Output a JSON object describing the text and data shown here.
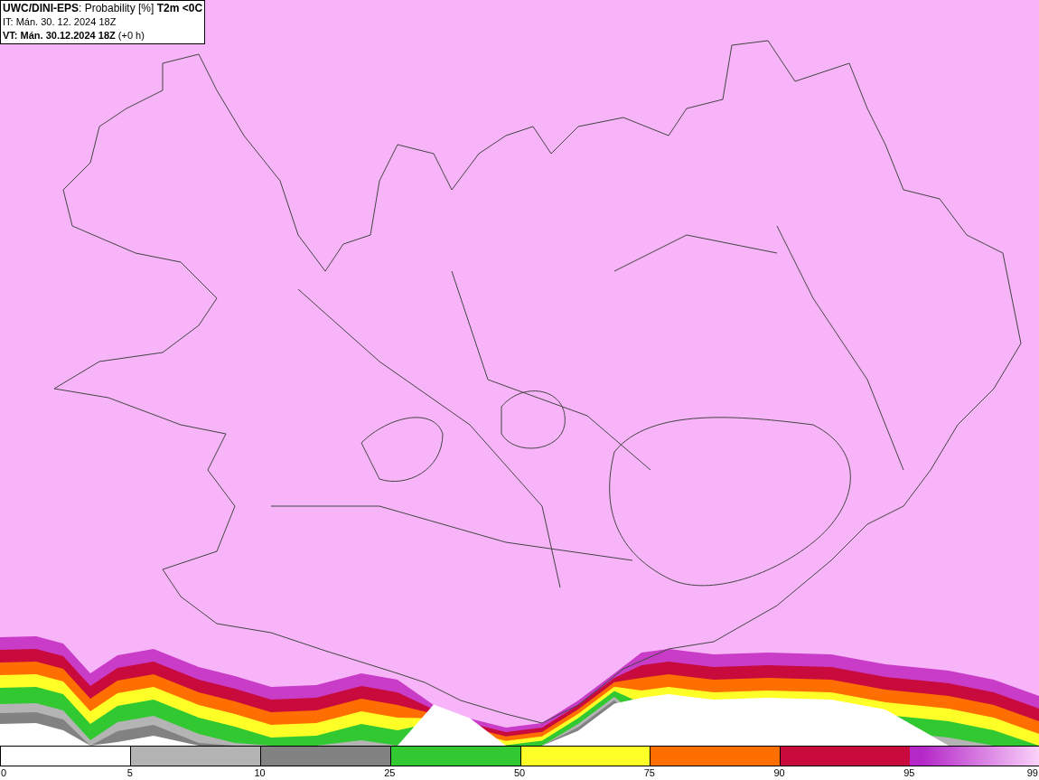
{
  "header": {
    "title": "**UWC/DINI-EPS**: Probability [%] **T2m <0C**",
    "initial_time": "IT: Mán. 30. 12. 2024 18Z",
    "valid_time": "**VT: Mán. 30.12.2024 18Z** (+0 h)"
  },
  "legend": {
    "segments": [
      {
        "color": "#ffffff"
      },
      {
        "color": "#b4b4b4"
      },
      {
        "color": "#828282"
      },
      {
        "color": "#32c832"
      },
      {
        "color": "#ffff28"
      },
      {
        "color": "#ff6e00"
      },
      {
        "color": "#c80a3c"
      },
      {
        "color": "#b428c8"
      }
    ],
    "ticks": [
      "0",
      "5",
      "10",
      "25",
      "50",
      "75",
      "90",
      "95",
      "99"
    ]
  }
}
